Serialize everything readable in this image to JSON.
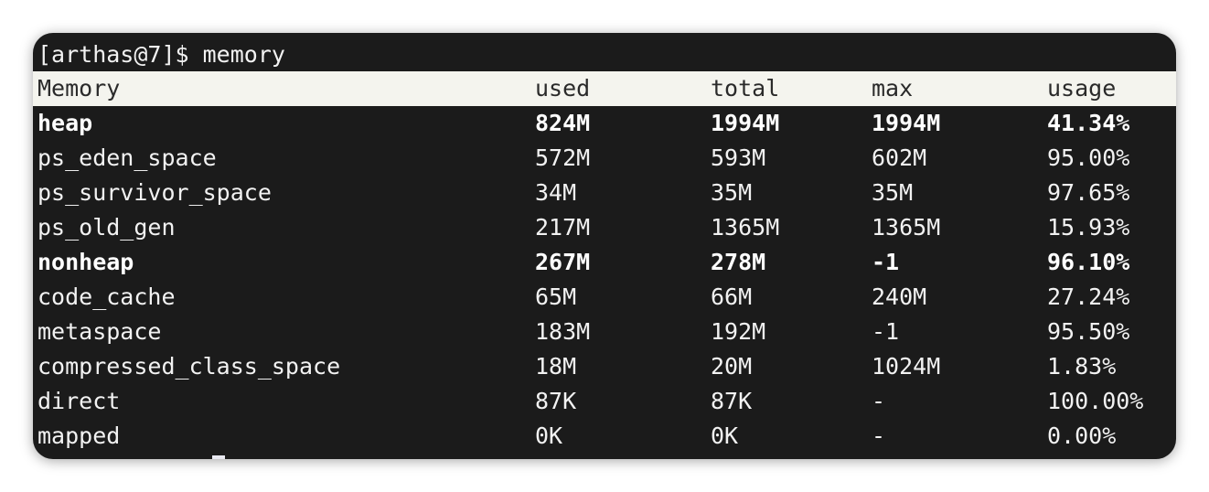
{
  "terminal": {
    "prompt": "[arthas@7]$ memory",
    "columns": [
      "Memory",
      "used",
      "total",
      "max",
      "usage"
    ],
    "rows": [
      {
        "name": "heap",
        "used": "824M",
        "total": "1994M",
        "max": "1994M",
        "usage": "41.34%",
        "bold": true
      },
      {
        "name": "ps_eden_space",
        "used": "572M",
        "total": "593M",
        "max": "602M",
        "usage": "95.00%",
        "bold": false
      },
      {
        "name": "ps_survivor_space",
        "used": "34M",
        "total": "35M",
        "max": "35M",
        "usage": "97.65%",
        "bold": false
      },
      {
        "name": "ps_old_gen",
        "used": "217M",
        "total": "1365M",
        "max": "1365M",
        "usage": "15.93%",
        "bold": false
      },
      {
        "name": "nonheap",
        "used": "267M",
        "total": "278M",
        "max": "-1",
        "usage": "96.10%",
        "bold": true
      },
      {
        "name": "code_cache",
        "used": "65M",
        "total": "66M",
        "max": "240M",
        "usage": "27.24%",
        "bold": false
      },
      {
        "name": "metaspace",
        "used": "183M",
        "total": "192M",
        "max": "-1",
        "usage": "95.50%",
        "bold": false
      },
      {
        "name": "compressed_class_space",
        "used": "18M",
        "total": "20M",
        "max": "1024M",
        "usage": "1.83%",
        "bold": false
      },
      {
        "name": "direct",
        "used": "87K",
        "total": "87K",
        "max": "-",
        "usage": "100.00%",
        "bold": false
      },
      {
        "name": "mapped",
        "used": "0K",
        "total": "0K",
        "max": "-",
        "usage": "0.00%",
        "bold": false
      }
    ]
  },
  "colors": {
    "background": "#1b1b1b",
    "header_bg": "#f4f4ee",
    "text": "#f2f2f2"
  }
}
